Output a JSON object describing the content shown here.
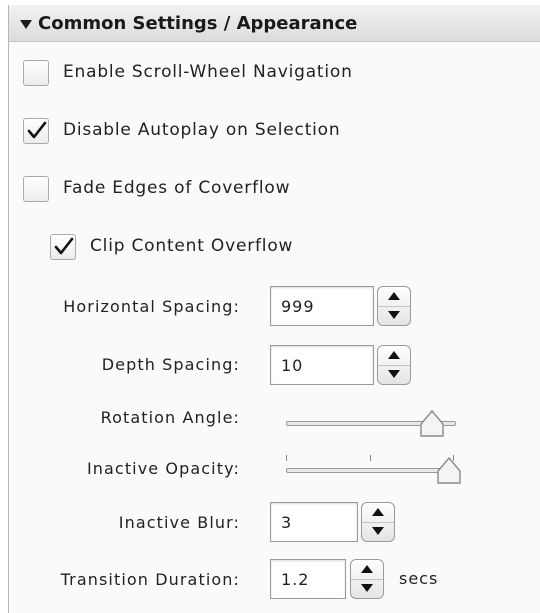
{
  "section": {
    "title": "Common Settings / Appearance",
    "expanded": true
  },
  "checkboxes": [
    {
      "label": "Enable Scroll-Wheel Navigation",
      "checked": false
    },
    {
      "label": "Disable Autoplay on Selection",
      "checked": true
    },
    {
      "label": "Fade Edges of Coverflow",
      "checked": false
    },
    {
      "label": "Clip Content Overflow",
      "checked": true
    }
  ],
  "fields": {
    "horizontal_spacing": {
      "label": "Horizontal Spacing:",
      "value": "999"
    },
    "depth_spacing": {
      "label": "Depth Spacing:",
      "value": "10"
    },
    "inactive_blur": {
      "label": "Inactive Blur:",
      "value": "3"
    },
    "transition_duration": {
      "label": "Transition Duration:",
      "value": "1.2",
      "unit": "secs"
    }
  },
  "sliders": {
    "rotation_angle": {
      "label": "Rotation Angle:",
      "level": 0.86
    },
    "inactive_opacity": {
      "label": "Inactive Opacity:",
      "level": 0.96
    }
  },
  "icons": {
    "disclosure": "disclosure-triangle-icon",
    "check": "checkmark-icon",
    "stepper_up": "arrow-up-icon",
    "stepper_down": "arrow-down-icon",
    "slider_thumb": "slider-thumb-icon"
  }
}
